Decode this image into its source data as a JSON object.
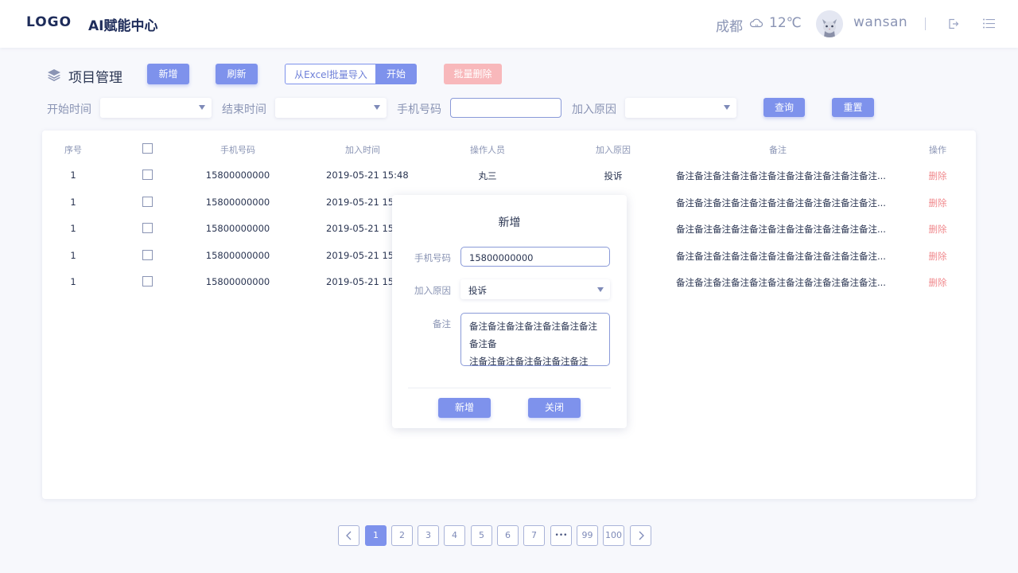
{
  "header": {
    "logo": "LOGO",
    "app_title": "AI赋能中心",
    "city": "成都",
    "temperature": "12℃",
    "username": "wansan"
  },
  "toolbar": {
    "title": "项目管理",
    "add_label": "新增",
    "refresh_label": "刷新",
    "import_label": "从Excel批量导入",
    "start_label": "开始",
    "batch_delete_label": "批量删除"
  },
  "filters": {
    "start_time_label": "开始时间",
    "end_time_label": "结束时间",
    "phone_label": "手机号码",
    "reason_label": "加入原因",
    "query_label": "查询",
    "reset_label": "重置"
  },
  "table": {
    "columns": [
      "序号",
      "手机号码",
      "加入时间",
      "操作人员",
      "加入原因",
      "备注",
      "操作"
    ],
    "rows": [
      {
        "index": "1",
        "phone": "15800000000",
        "time": "2019-05-21 15:48",
        "operator": "丸三",
        "reason": "投诉",
        "note": "备注备注备注备注备注备注备注备注备注备注备注...",
        "action": "删除"
      },
      {
        "index": "1",
        "phone": "15800000000",
        "time": "2019-05-21 15:4",
        "operator": "",
        "reason": "",
        "note": "备注备注备注备注备注备注备注备注备注备注备注...",
        "action": "删除"
      },
      {
        "index": "1",
        "phone": "15800000000",
        "time": "2019-05-21 15:4",
        "operator": "",
        "reason": "",
        "note": "备注备注备注备注备注备注备注备注备注备注备注...",
        "action": "删除"
      },
      {
        "index": "1",
        "phone": "15800000000",
        "time": "2019-05-21 15:4",
        "operator": "",
        "reason": "",
        "note": "备注备注备注备注备注备注备注备注备注备注备注...",
        "action": "删除"
      },
      {
        "index": "1",
        "phone": "15800000000",
        "time": "2019-05-21 15:4",
        "operator": "",
        "reason": "",
        "note": "备注备注备注备注备注备注备注备注备注备注备注...",
        "action": "删除"
      }
    ]
  },
  "modal": {
    "title": "新增",
    "phone_label": "手机号码",
    "phone_value": "15800000000",
    "reason_label": "加入原因",
    "reason_value": "投诉",
    "note_label": "备注",
    "note_line1": "备注备注备注备注备注备注备注备注备",
    "note_line2": "注备注备注备注备注备注备注",
    "confirm_label": "新增",
    "close_label": "关闭"
  },
  "pagination": {
    "pages": [
      "1",
      "2",
      "3",
      "4",
      "5",
      "6",
      "7",
      "•••",
      "99",
      "100"
    ],
    "current": "1"
  },
  "colors": {
    "primary": "#7e92ec",
    "danger": "#f08a8e",
    "text": "#2a3552",
    "muted": "#8a94b4"
  }
}
